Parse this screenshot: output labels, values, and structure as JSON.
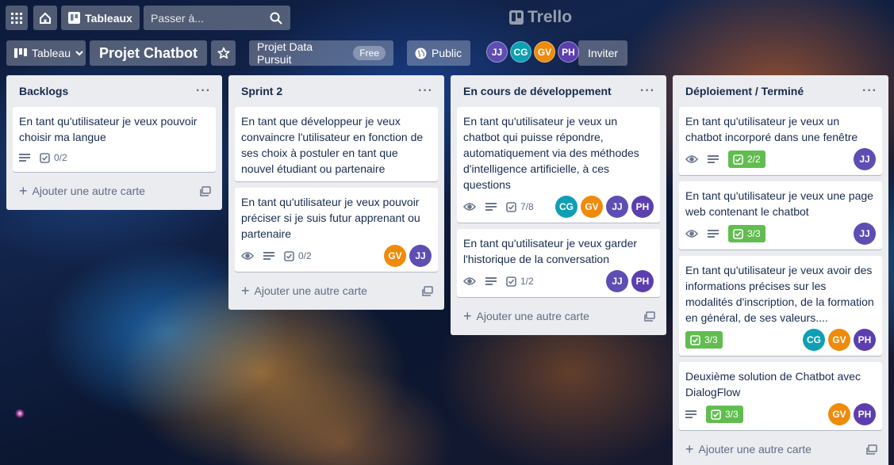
{
  "header": {
    "boards_label": "Tableaux",
    "search_placeholder": "Passer à...",
    "logo_text": "Trello"
  },
  "board": {
    "view_label": "Tableau",
    "title": "Projet Chatbot",
    "team_label": "Projet Data Pursuit",
    "team_plan": "Free",
    "visibility_label": "Public",
    "invite_label": "Inviter",
    "members": [
      "JJ",
      "CG",
      "GV",
      "PH"
    ]
  },
  "icons": {
    "apps": "apps-grid-icon",
    "home": "home-icon",
    "boards": "boards-icon",
    "search": "search-icon",
    "star": "star-icon",
    "globe": "globe-icon",
    "eye": "watch-eye-icon",
    "description": "description-icon",
    "checklist": "checklist-icon",
    "plus": "plus-icon",
    "template": "card-template-icon"
  },
  "colors": {
    "list_bg": "#ebecf0",
    "complete_badge": "#61bd4f",
    "avatar_jj": "#5e4db2",
    "avatar_cg": "#0f9fb4",
    "avatar_gv": "#f08a0a",
    "avatar_ph": "#5c3fae"
  },
  "lists": [
    {
      "title": "Backlogs",
      "add_label": "Ajouter une autre carte",
      "cards": [
        {
          "text": "En tant qu'utilisateur je veux pouvoir choisir ma langue",
          "checklist": "0/2"
        }
      ]
    },
    {
      "title": "Sprint 2",
      "add_label": "Ajouter une autre carte",
      "cards": [
        {
          "text": "En tant que développeur je veux convaincre l'utilisateur en fonction de ses choix à postuler en tant que nouvel étudiant ou partenaire"
        },
        {
          "text": "En tant qu'utilisateur je veux pouvoir préciser si je suis futur apprenant ou partenaire",
          "checklist": "0/2",
          "members": [
            "GV",
            "JJ"
          ]
        }
      ]
    },
    {
      "title": "En cours de développement",
      "add_label": "Ajouter une autre carte",
      "cards": [
        {
          "text": "En tant qu'utilisateur je veux un chatbot qui puisse répondre, automatiquement via des méthodes d'intelligence artificielle, à ces questions",
          "checklist": "7/8",
          "members": [
            "CG",
            "GV",
            "JJ",
            "PH"
          ]
        },
        {
          "text": "En tant qu'utilisateur je veux garder l'historique de la conversation",
          "checklist": "1/2",
          "members": [
            "JJ",
            "PH"
          ]
        }
      ]
    },
    {
      "title": "Déploiement / Terminé",
      "add_label": "Ajouter une autre carte",
      "cards": [
        {
          "text": "En tant qu'utilisateur je veux un chatbot incorporé dans une fenêtre",
          "checklist": "2/2",
          "members": [
            "JJ"
          ]
        },
        {
          "text": "En tant qu'utilisateur je veux une page web contenant le chatbot",
          "checklist": "3/3",
          "members": [
            "JJ"
          ]
        },
        {
          "text": "En tant qu'utilisateur je veux avoir des informations précises sur les modalités d'inscription, de la formation en général, de ses valeurs....",
          "checklist": "3/3",
          "members": [
            "CG",
            "GV",
            "PH"
          ]
        },
        {
          "text": "Deuxième solution de Chatbot avec DialogFlow",
          "checklist": "3/3",
          "members": [
            "GV",
            "PH"
          ]
        }
      ]
    }
  ]
}
